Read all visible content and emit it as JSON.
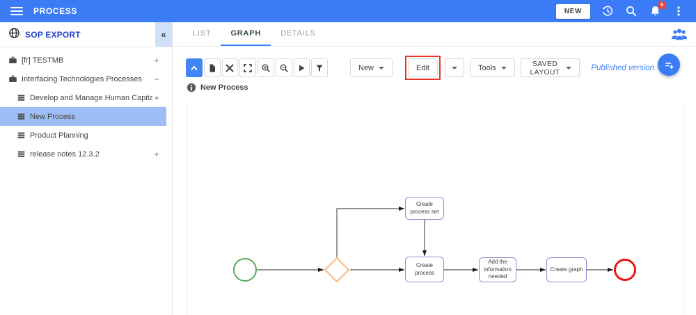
{
  "header": {
    "title": "PROCESS",
    "new_button": "NEW",
    "notification_count": "6"
  },
  "sidebar": {
    "title": "SOP EXPORT",
    "collapse_glyph": "«",
    "items": [
      {
        "label": "[fr] TESTMB",
        "type": "library",
        "expander": "+",
        "level": 0,
        "selected": false
      },
      {
        "label": "Interfacing Technologies Processes",
        "type": "library",
        "expander": "−",
        "level": 0,
        "selected": false
      },
      {
        "label": "Develop and Manage Human Capital",
        "type": "process",
        "expander": "+",
        "level": 1,
        "selected": false
      },
      {
        "label": "New Process",
        "type": "process",
        "expander": "",
        "level": 1,
        "selected": true
      },
      {
        "label": "Product Planning",
        "type": "process",
        "expander": "",
        "level": 1,
        "selected": false
      },
      {
        "label": "release notes 12.3.2",
        "type": "process",
        "expander": "+",
        "level": 1,
        "selected": false
      }
    ]
  },
  "main": {
    "tabs": [
      {
        "label": "LIST",
        "active": false
      },
      {
        "label": "GRAPH",
        "active": true
      },
      {
        "label": "DETAILS",
        "active": false
      }
    ],
    "toolbar": {
      "new_label": "New",
      "edit_label": "Edit",
      "tools_label": "Tools",
      "saved_layout_label": "SAVED LAYOUT",
      "version_label": "Published version"
    },
    "process_title": "New Process"
  },
  "diagram": {
    "tasks": [
      {
        "label": "Create process set"
      },
      {
        "label": "Create process"
      },
      {
        "label": "Add the information needed"
      },
      {
        "label": "Create graph"
      }
    ],
    "events": [
      {
        "type": "start"
      },
      {
        "type": "end"
      }
    ],
    "gateways": [
      {
        "type": "exclusive"
      }
    ]
  },
  "colors": {
    "topbar": "#3b7cf6",
    "accent_blue": "#4285f4",
    "sidebar_selected": "#9dbdf4",
    "collapse_chip": "#cfe0f8",
    "sop_title": "#2342d0",
    "published_version": "#4285f4",
    "edit_highlight": "#e8392b",
    "task_border": "#8890d4",
    "start_event": "#56a85c",
    "end_event": "#ec1313",
    "gateway": "#f6b87e",
    "notification_badge": "#ea4335"
  }
}
